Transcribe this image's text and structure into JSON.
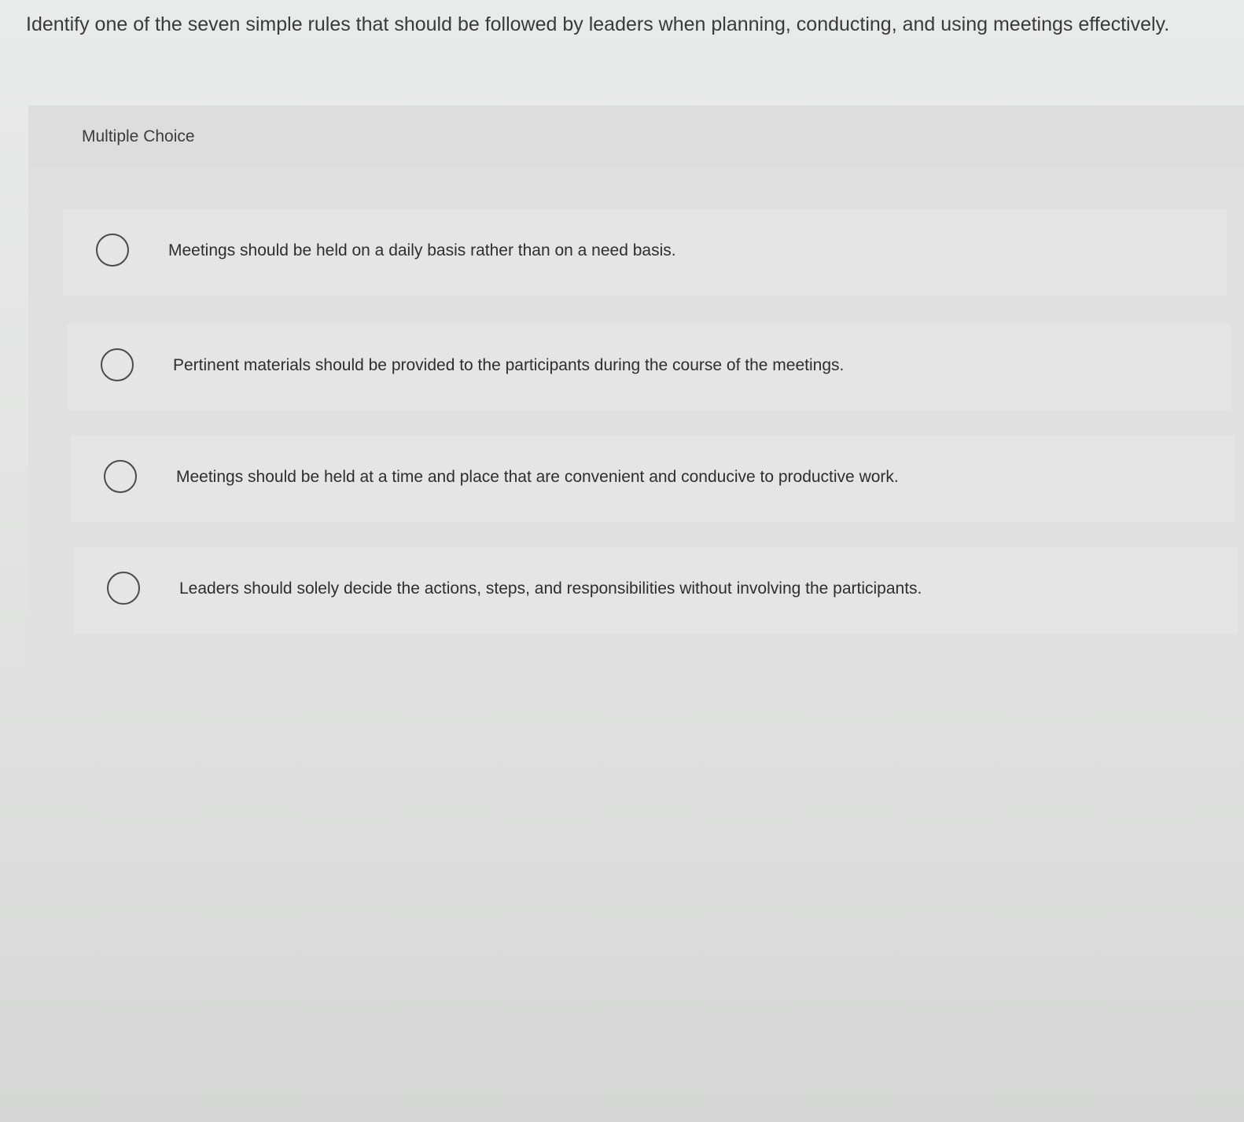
{
  "question": {
    "text": "Identify one of the seven simple rules that should be followed by leaders when planning, conducting, and using meetings effectively."
  },
  "multiple_choice": {
    "label": "Multiple Choice",
    "choices": [
      {
        "text": "Meetings should be held on a daily basis rather than on a need basis.",
        "selected": false
      },
      {
        "text": "Pertinent materials should be provided to the participants during the course of the meetings.",
        "selected": false
      },
      {
        "text": "Meetings should be held at a time and place that are convenient and conducive to productive work.",
        "selected": false
      },
      {
        "text": "Leaders should solely decide the actions, steps, and responsibilities without involving the participants.",
        "selected": false
      }
    ]
  }
}
